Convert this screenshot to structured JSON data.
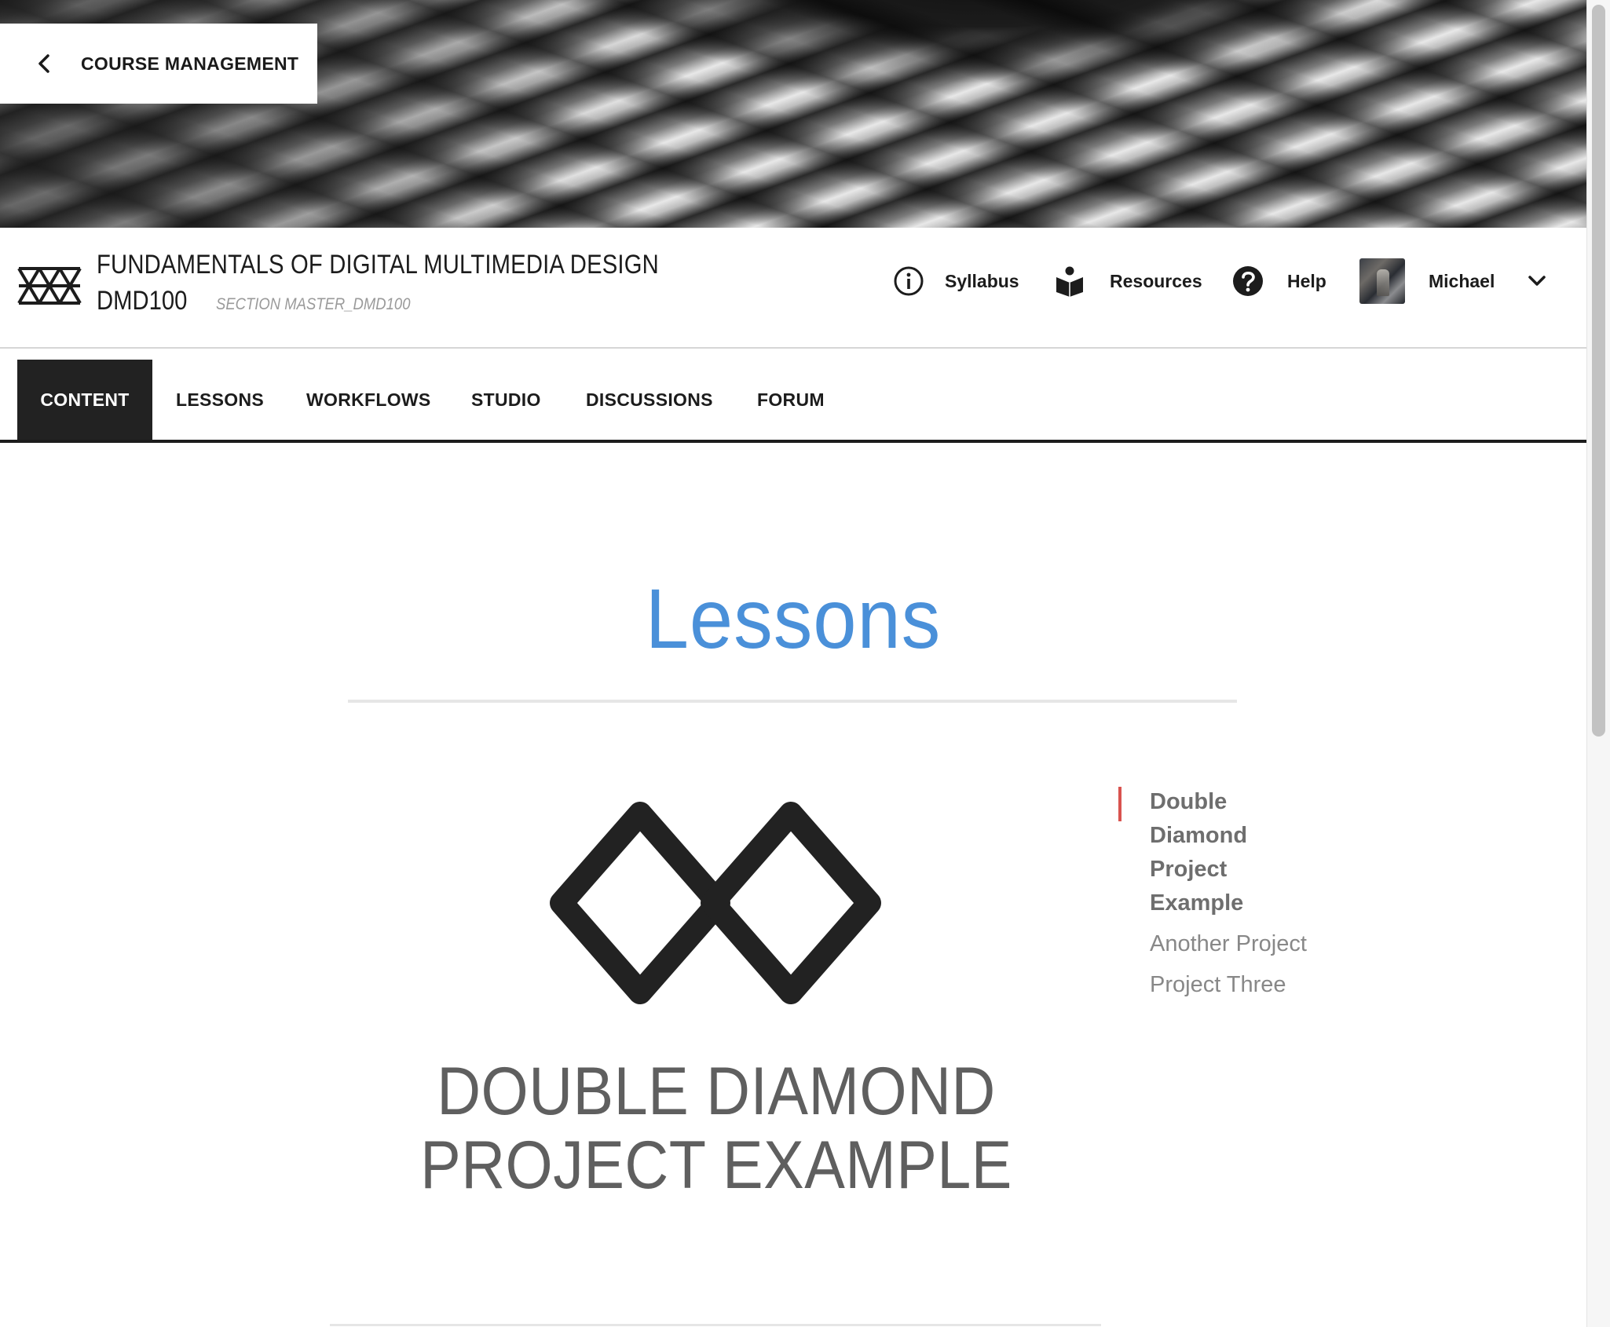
{
  "back_link": {
    "label": "COURSE MANAGEMENT"
  },
  "course": {
    "title": "FUNDAMENTALS OF DIGITAL MULTIMEDIA DESIGN",
    "code": "DMD100",
    "section": "SECTION MASTER_DMD100"
  },
  "header_links": {
    "syllabus": "Syllabus",
    "resources": "Resources",
    "help": "Help",
    "user_name": "Michael"
  },
  "tabs": [
    {
      "label": "CONTENT",
      "active": true
    },
    {
      "label": "LESSONS",
      "active": false
    },
    {
      "label": "WORKFLOWS",
      "active": false
    },
    {
      "label": "STUDIO",
      "active": false
    },
    {
      "label": "DISCUSSIONS",
      "active": false
    },
    {
      "label": "FORUM",
      "active": false
    }
  ],
  "main": {
    "heading": "Lessons",
    "project_title_line1": "DOUBLE DIAMOND",
    "project_title_line2": "PROJECT EXAMPLE"
  },
  "side_nav": {
    "items": [
      {
        "label": "Double Diamond Project Example",
        "active": true
      },
      {
        "label": "Another Project",
        "active": false
      },
      {
        "label": "Project Three",
        "active": false
      }
    ]
  },
  "colors": {
    "heading_blue": "#4a90d9",
    "active_tab_bg": "#222222",
    "active_indicator": "#d9534f"
  },
  "icons": {
    "back": "chevron-left-icon",
    "logo": "triangles-logo-icon",
    "syllabus": "info-circle-icon",
    "resources": "book-reader-icon",
    "help": "question-circle-icon",
    "user_menu": "chevron-down-icon",
    "lesson": "double-diamond-icon"
  }
}
